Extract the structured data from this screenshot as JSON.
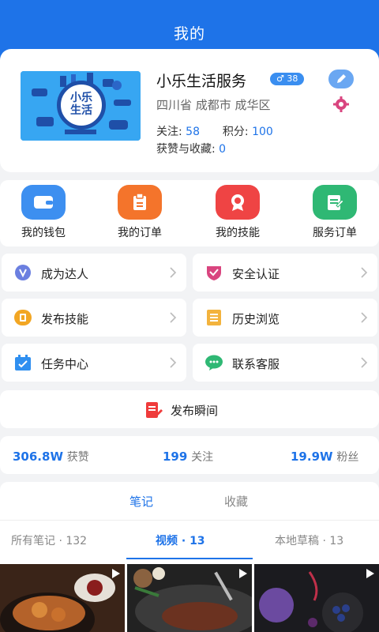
{
  "header": {
    "title": "我的"
  },
  "profile": {
    "avatar_text": "小乐\n生活",
    "avatar_line1": "小乐",
    "avatar_line2": "生活",
    "name": "小乐生活服务",
    "gender_badge": "♂ 38",
    "location": "四川省 成都市 成华区",
    "follow_label": "关注:",
    "follow_value": "58",
    "points_label": "积分:",
    "points_value": "100",
    "likes_label": "获赞与收藏:",
    "likes_value": "0"
  },
  "quick_actions": [
    {
      "label": "我的钱包",
      "icon": "wallet-icon",
      "color": "#3d8ff0"
    },
    {
      "label": "我的订单",
      "icon": "order-icon",
      "color": "#f4742b"
    },
    {
      "label": "我的技能",
      "icon": "skill-badge-icon",
      "color": "#ef4444"
    },
    {
      "label": "服务订单",
      "icon": "service-order-icon",
      "color": "#2fb874"
    }
  ],
  "menu": [
    {
      "label": "成为达人",
      "icon": "v-badge-icon",
      "color": "#6b7fe0"
    },
    {
      "label": "安全认证",
      "icon": "shield-check-icon",
      "color": "#d9457f"
    },
    {
      "label": "发布技能",
      "icon": "publish-skill-icon",
      "color": "#f2a623"
    },
    {
      "label": "历史浏览",
      "icon": "history-list-icon",
      "color": "#f3b33d"
    },
    {
      "label": "任务中心",
      "icon": "task-calendar-icon",
      "color": "#2f8ff0"
    },
    {
      "label": "联系客服",
      "icon": "chat-bubble-icon",
      "color": "#2fb874"
    }
  ],
  "publish": {
    "label": "发布瞬间",
    "icon": "edit-note-icon"
  },
  "stats": [
    {
      "value": "306.8W",
      "unit": "获赞"
    },
    {
      "value": "199",
      "unit": "关注"
    },
    {
      "value": "19.9W",
      "unit": "粉丝"
    }
  ],
  "tabs": [
    {
      "label": "笔记"
    },
    {
      "label": "收藏"
    }
  ],
  "subtabs": [
    {
      "label": "所有笔记",
      "count": "· 132"
    },
    {
      "label": "视频",
      "count": "· 13"
    },
    {
      "label": "本地草稿",
      "count": "· 13"
    }
  ],
  "colors": {
    "primary": "#1e73e8",
    "background": "#f2f3f5"
  }
}
